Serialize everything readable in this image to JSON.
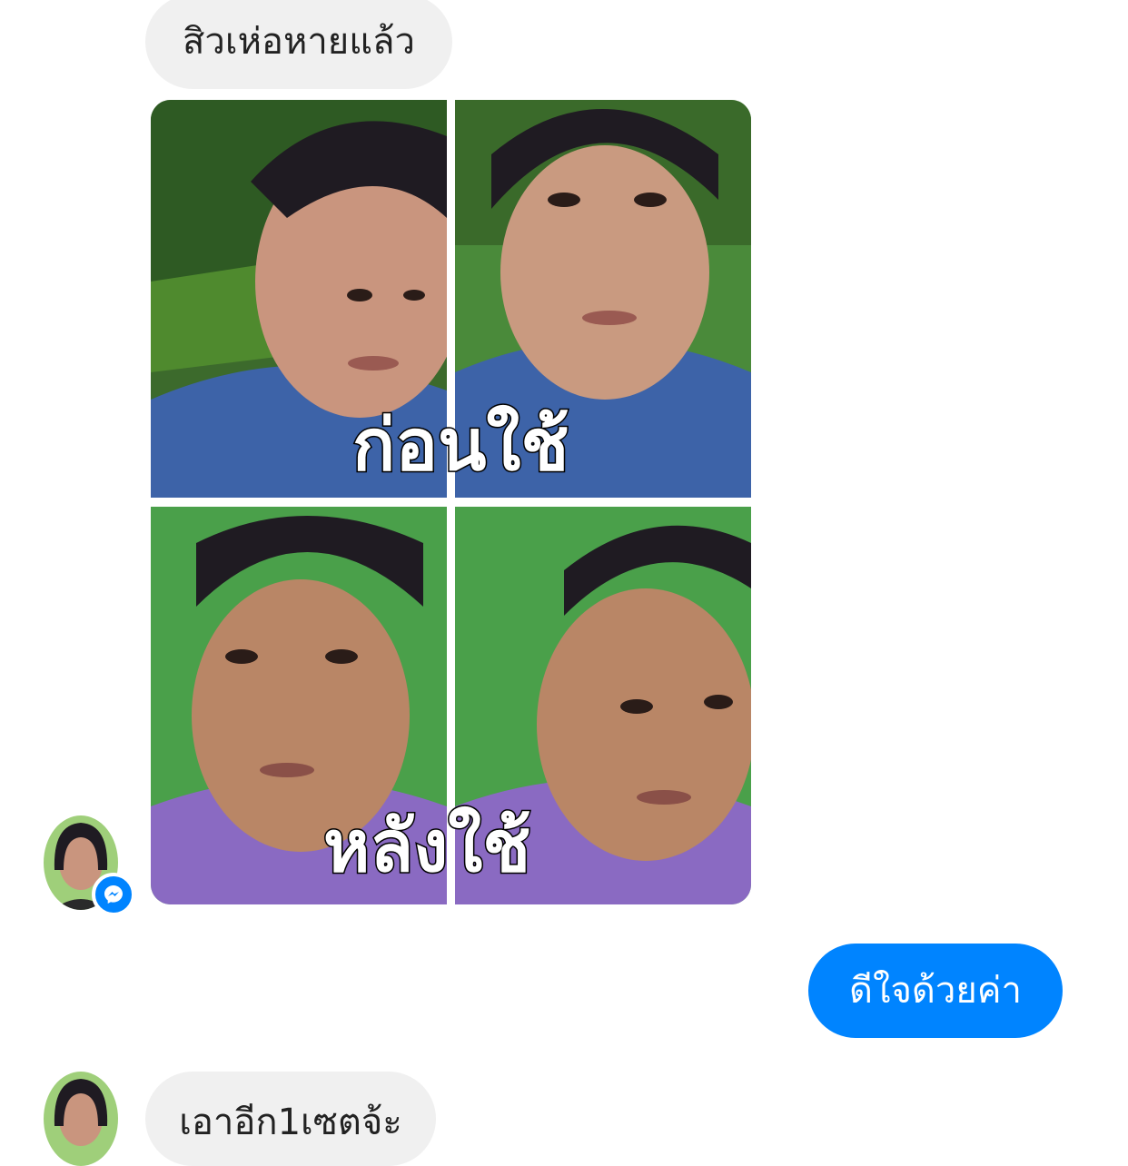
{
  "messages": {
    "first": "สิวเห่อหายแล้ว",
    "photo_before_label": "ก่อนใช้",
    "photo_after_label": "หลังใช้",
    "reply": "ดีใจด้วยค่า",
    "last": "เอาอีก1เซตจ้ะ"
  },
  "icons": {
    "messenger_badge": "messenger-icon"
  },
  "colors": {
    "incoming_bubble": "#f0f0f0",
    "outgoing_bubble": "#0084ff",
    "background": "#ffffff"
  }
}
